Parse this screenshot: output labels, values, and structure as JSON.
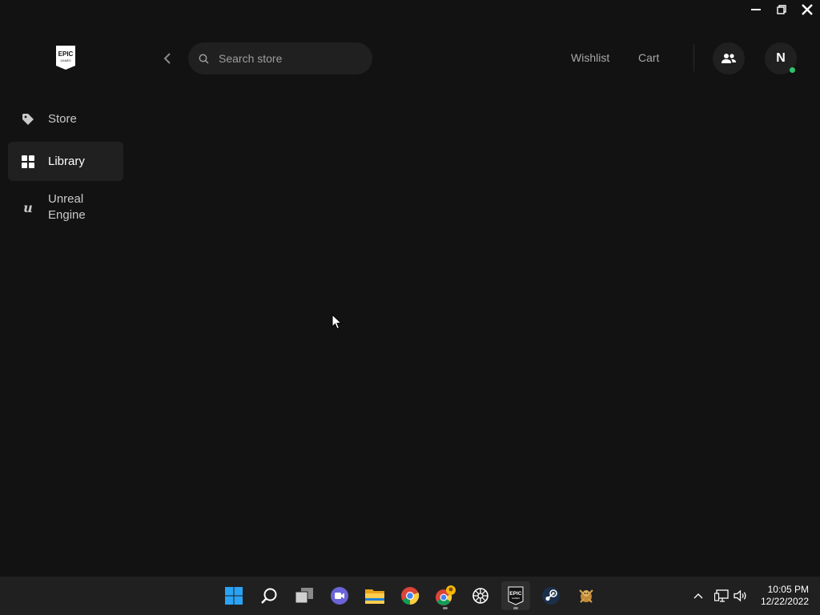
{
  "window": {
    "controls": [
      "minimize",
      "restore",
      "close"
    ]
  },
  "sidebar": {
    "logo_text": "EPIC GAMES",
    "items": [
      {
        "label": "Store",
        "icon": "tag-icon",
        "active": false
      },
      {
        "label": "Library",
        "icon": "grid-icon",
        "active": true
      },
      {
        "label": "Unreal\nEngine",
        "icon": "unreal-engine-icon",
        "active": false
      }
    ]
  },
  "header": {
    "search_placeholder": "Search store",
    "wishlist_label": "Wishlist",
    "cart_label": "Cart",
    "avatar_initial": "N",
    "online_status_color": "#2ec36b"
  },
  "taskbar": {
    "apps": [
      "windows-start-icon",
      "search-icon",
      "task-view-icon",
      "teams-chat-icon",
      "file-explorer-icon",
      "chrome-icon",
      "chrome-profile-icon",
      "app-icon",
      "epic-games-icon",
      "steam-icon",
      "game-icon"
    ],
    "tray": [
      "chevron-up-icon",
      "network-icon",
      "volume-icon"
    ],
    "time": "10:05 PM",
    "date": "12/22/2022"
  },
  "colors": {
    "background": "#121212",
    "panel": "#202020",
    "accent_online": "#2ec36b"
  }
}
